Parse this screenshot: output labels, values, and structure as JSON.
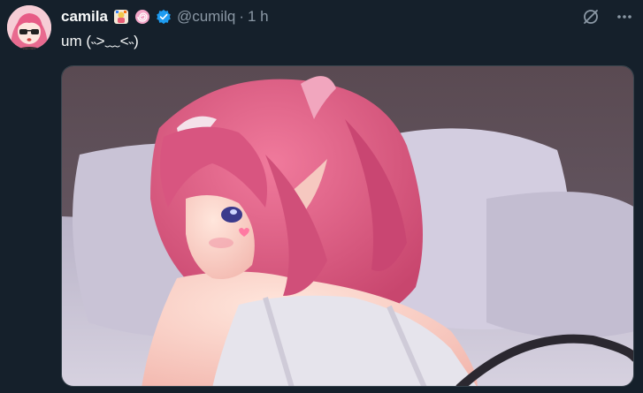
{
  "tweet": {
    "display_name": "camila",
    "handle": "@cumilq",
    "separator": "·",
    "time": "1 h",
    "text": "um (˵>﹏<˵)"
  },
  "icons": {
    "avatar": "avatar-image",
    "badge_1": "emoji-badge-icon",
    "badge_2": "lollipop-badge-icon",
    "verified": "verified-check-icon",
    "grok": "grok-icon",
    "more": "more-options-icon"
  },
  "colors": {
    "background": "#15202b",
    "text": "#f7f9f9",
    "secondary_text": "#8b98a5",
    "verified": "#1d9bf0",
    "border": "#38444d"
  }
}
